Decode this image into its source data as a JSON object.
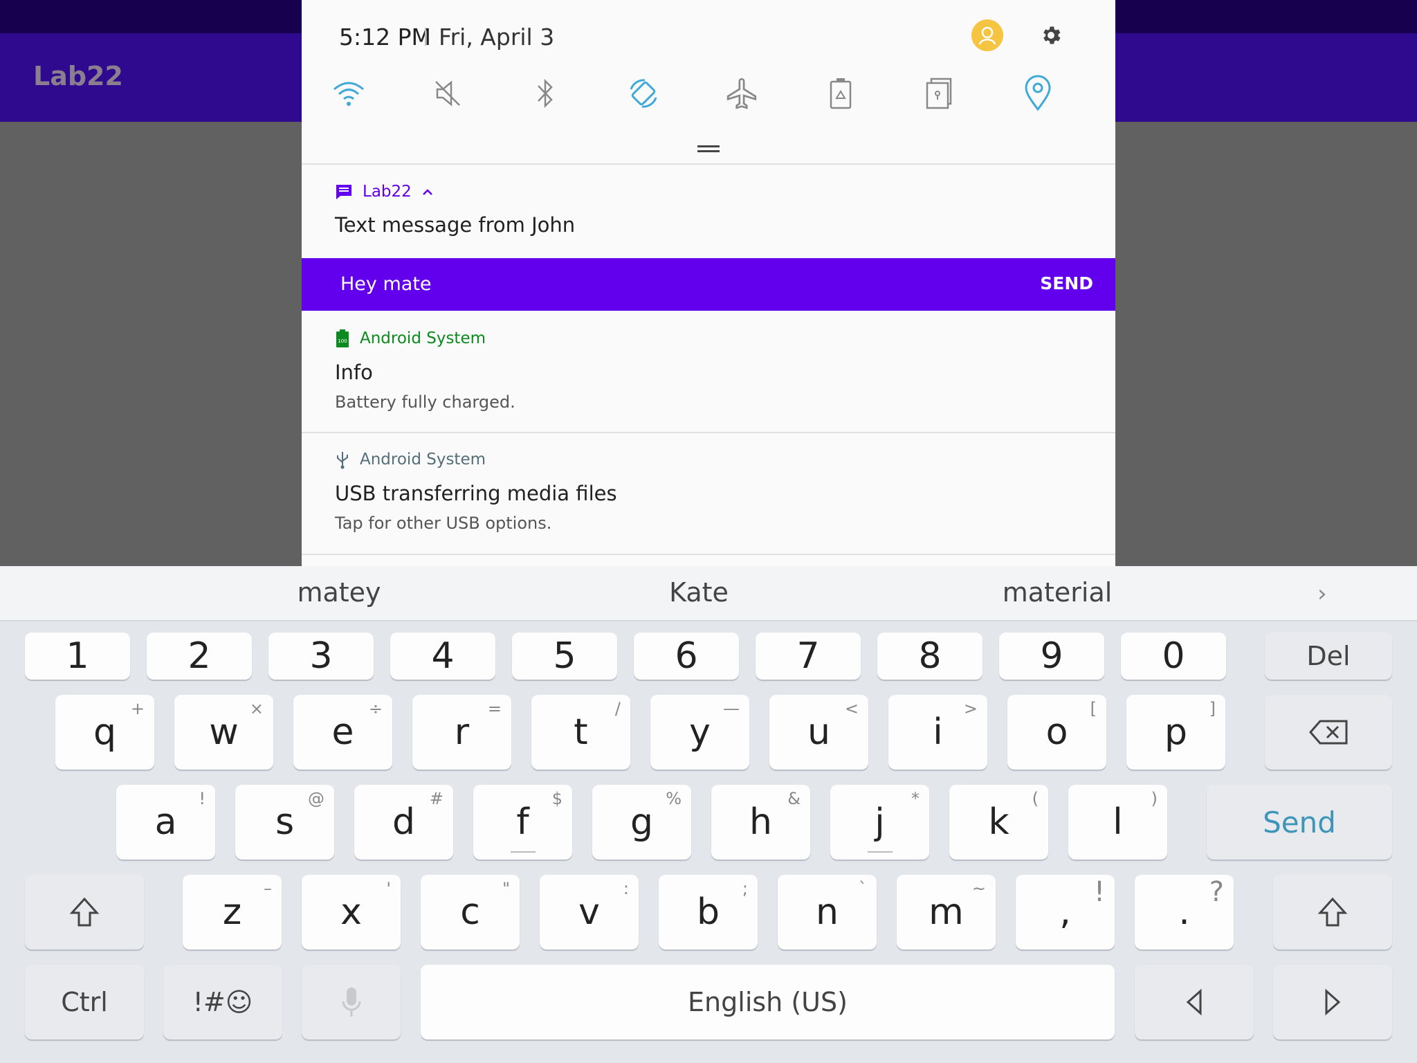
{
  "background_app": {
    "title": "Lab22"
  },
  "shade": {
    "clock": "5:12 PM",
    "date": "Fri, April 3",
    "quick_settings": [
      "wifi-icon",
      "mute-icon",
      "bluetooth-icon",
      "auto-rotate-icon",
      "airplane-mode-icon",
      "power-saving-icon",
      "secure-folder-icon",
      "location-icon"
    ]
  },
  "notifications": [
    {
      "app": "Lab22",
      "title": "Text message from John",
      "app_color": "#6200ee"
    },
    {
      "app": "Android System",
      "title": "Info",
      "text": "Battery fully charged.",
      "app_color": "#0b8a1f"
    },
    {
      "app": "Android System",
      "title": "USB transferring media files",
      "text": "Tap for other USB options.",
      "app_color": "#546e7a"
    }
  ],
  "reply": {
    "text": "Hey mate",
    "send_label": "SEND"
  },
  "keyboard": {
    "suggestions": [
      "matey",
      "Kate",
      "material"
    ],
    "number_row": [
      "1",
      "2",
      "3",
      "4",
      "5",
      "6",
      "7",
      "8",
      "9",
      "0"
    ],
    "del_label": "Del",
    "row_q": [
      [
        "q",
        "+"
      ],
      [
        "w",
        "×"
      ],
      [
        "e",
        "÷"
      ],
      [
        "r",
        "="
      ],
      [
        "t",
        "/"
      ],
      [
        "y",
        "—"
      ],
      [
        "u",
        "<"
      ],
      [
        "i",
        ">"
      ],
      [
        "o",
        "["
      ],
      [
        "p",
        "]"
      ]
    ],
    "row_a": [
      [
        "a",
        "!"
      ],
      [
        "s",
        "@"
      ],
      [
        "d",
        "#"
      ],
      [
        "f",
        "$"
      ],
      [
        "g",
        "%"
      ],
      [
        "h",
        "&"
      ],
      [
        "j",
        "*"
      ],
      [
        "k",
        "("
      ],
      [
        "l",
        ")"
      ]
    ],
    "send_label": "Send",
    "row_z": [
      [
        "z",
        "–"
      ],
      [
        "x",
        "'"
      ],
      [
        "c",
        "\""
      ],
      [
        "v",
        ":"
      ],
      [
        "b",
        ";"
      ],
      [
        "n",
        "`"
      ],
      [
        "m",
        "~"
      ],
      [
        ",",
        "!"
      ],
      [
        ".",
        "?"
      ]
    ],
    "ctrl_label": "Ctrl",
    "symbols_label": "!#☺",
    "space_label": "English (US)"
  },
  "colors": {
    "accent": "#6200ee",
    "toolbar": "#2f0a8f",
    "send_key": "#3d95b8"
  }
}
